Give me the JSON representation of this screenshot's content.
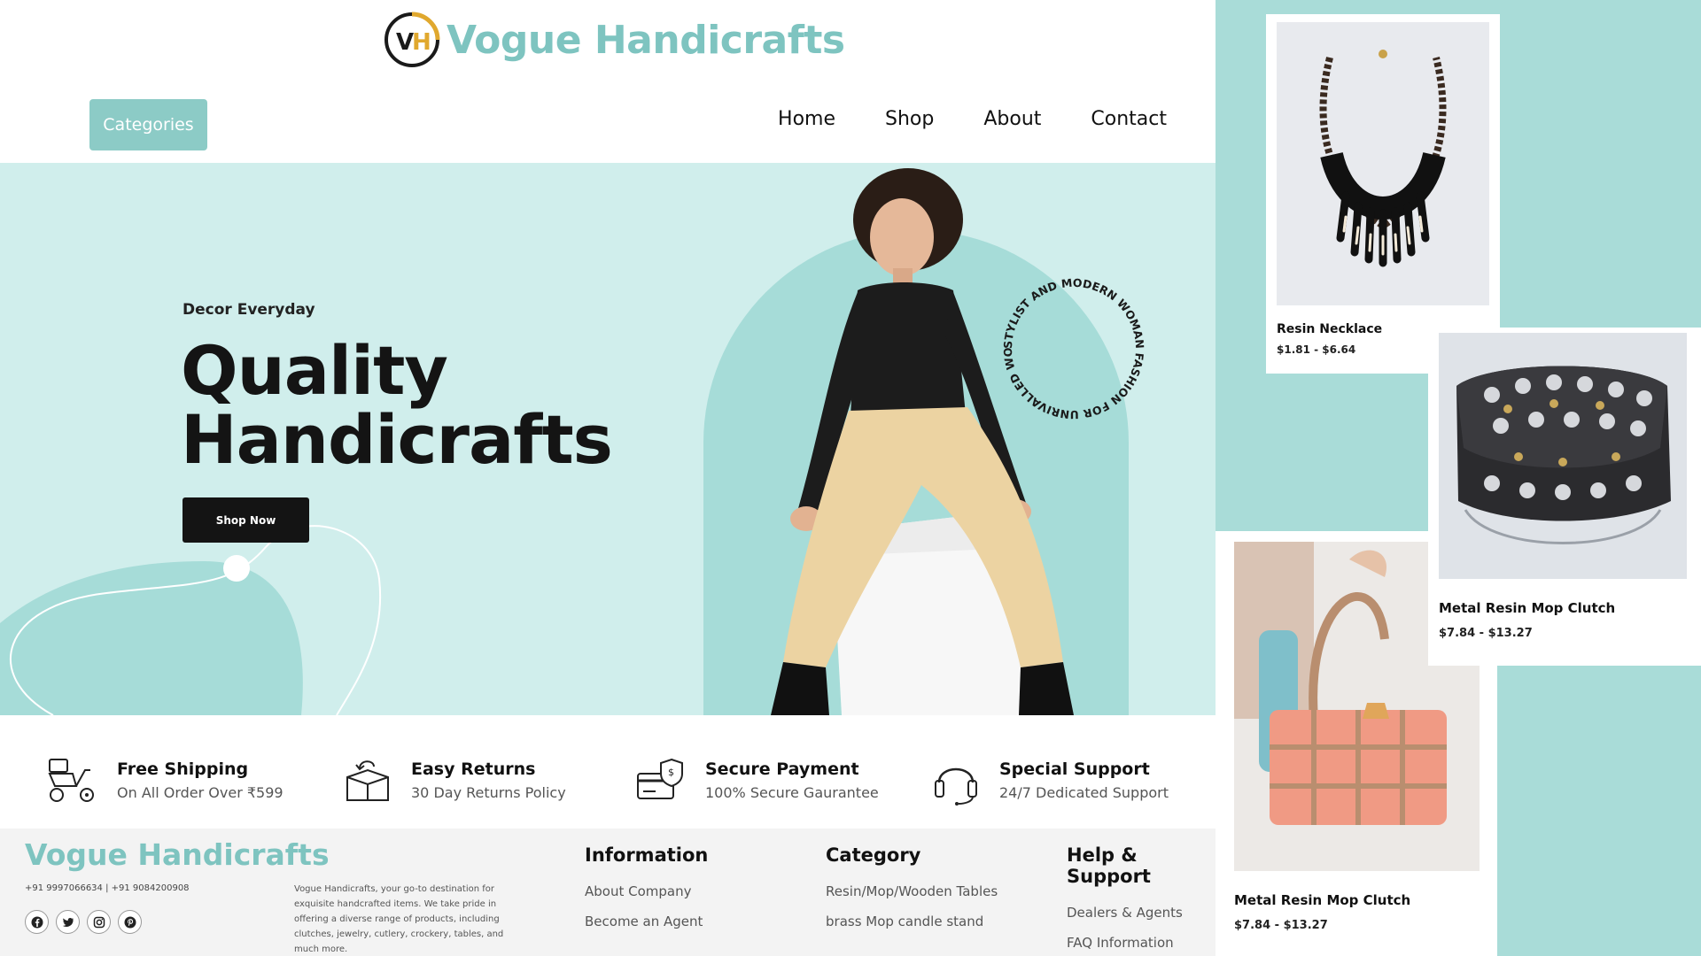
{
  "brand": {
    "name": "Vogue Handicrafts",
    "logo_initials": "VH"
  },
  "header": {
    "categories_label": "Categories",
    "nav": [
      "Home",
      "Shop",
      "About",
      "Contact"
    ]
  },
  "hero": {
    "kicker": "Decor Everyday",
    "title_line1": "Quality",
    "title_line2": "Handicrafts",
    "cta": "Shop Now",
    "ring_text": "STYLIST AND MODERN WOMAN FASHION FOR UNRIVALLED WOMAN"
  },
  "features": [
    {
      "title": "Free Shipping",
      "subtitle": "On All Order Over ₹599",
      "icon": "delivery-scooter-icon"
    },
    {
      "title": "Easy Returns",
      "subtitle": "30 Day Returns Policy",
      "icon": "return-box-icon"
    },
    {
      "title": "Secure Payment",
      "subtitle": "100% Secure Gaurantee",
      "icon": "secure-card-icon"
    },
    {
      "title": "Special Support",
      "subtitle": "24/7 Dedicated Support",
      "icon": "headset-icon"
    }
  ],
  "footer": {
    "logo": "Vogue Handicrafts",
    "phones": "+91 9997066634 | +91 9084200908",
    "about": "Vogue Handicrafts, your go-to destination for exquisite handcrafted items. We take pride in offering a diverse range of products, including clutches, jewelry, cutlery, crockery, tables, and much more.",
    "socials": [
      "facebook-icon",
      "twitter-icon",
      "instagram-icon",
      "pinterest-icon"
    ],
    "columns": [
      {
        "title": "Information",
        "links": [
          "About Company",
          "Become an Agent"
        ]
      },
      {
        "title": "Category",
        "links": [
          "Resin/Mop/Wooden Tables",
          "brass Mop candle stand"
        ]
      },
      {
        "title": "Help & Support",
        "links": [
          "Dealers & Agents",
          "FAQ Information"
        ]
      }
    ]
  },
  "products": [
    {
      "name": "Resin Necklace",
      "price": "$1.81 - $6.64"
    },
    {
      "name": "Metal Resin Mop Clutch",
      "price": "$7.84 - $13.27"
    },
    {
      "name": "Metal Resin Mop Clutch",
      "price": "$7.84 - $13.27"
    }
  ],
  "colors": {
    "accent": "#7ec4c0",
    "hero_bg": "#d0eeec",
    "collage_bg": "#a9dcd8",
    "dark": "#141414"
  }
}
